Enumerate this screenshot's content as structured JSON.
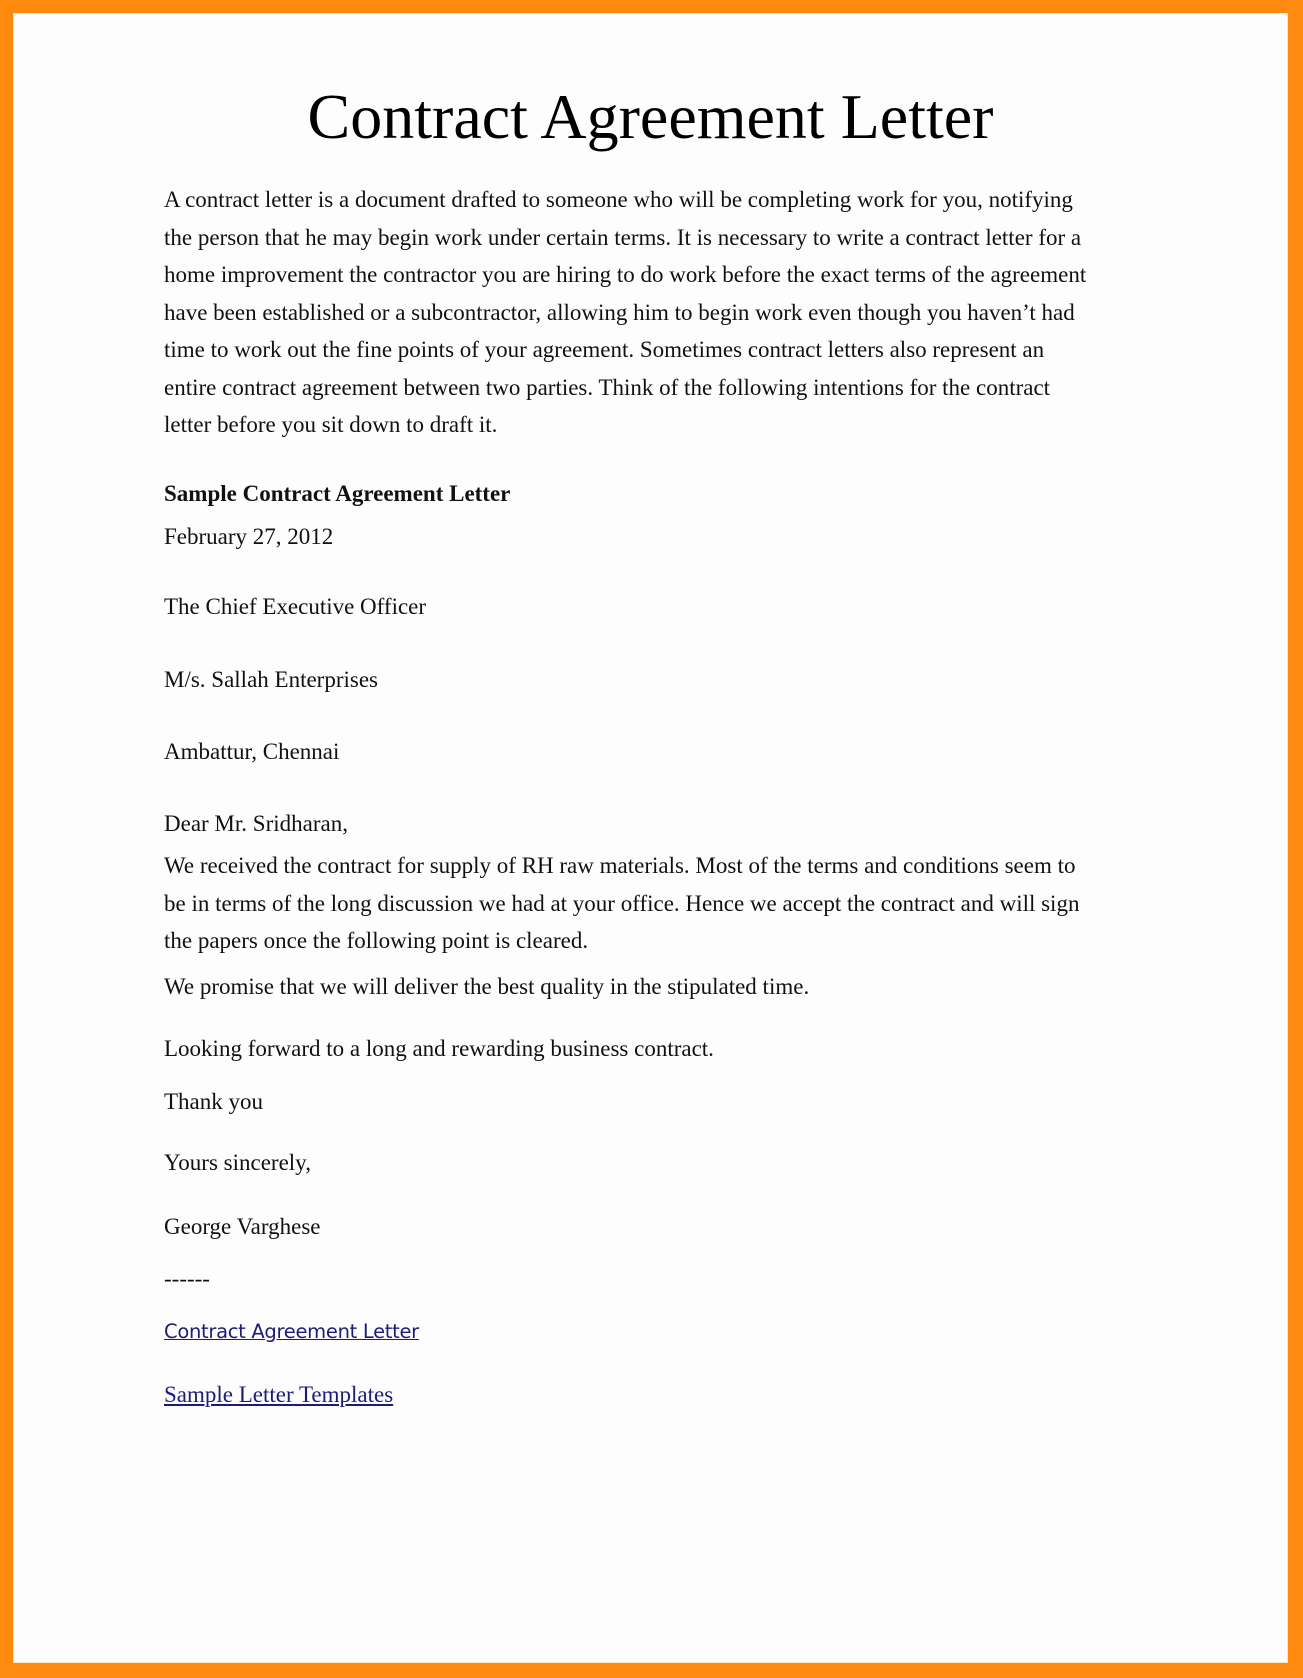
{
  "document": {
    "title": "Contract Agreement Letter",
    "intro_lines": [
      "A contract letter is a document drafted to someone who will be completing work for you, notifying",
      "the person that he may begin work under certain terms. It is necessary to write a contract letter for a",
      "home improvement the contractor you are hiring to do work before the exact terms of the agreement",
      "have been established or a subcontractor, allowing him to begin work even though you haven’t had",
      "time to work out the fine points of your agreement. Sometimes contract letters also represent an",
      "entire contract agreement between two parties. Think of the following intentions for the contract",
      "letter before you sit down to draft it."
    ],
    "sample_heading": "Sample Contract Agreement Letter",
    "date": "February 27, 2012",
    "recipient_title": "The Chief Executive Officer",
    "recipient_company": "M/s. Sallah Enterprises",
    "recipient_location": "Ambattur, Chennai",
    "salutation": "Dear Mr. Sridharan,",
    "body_lines": [
      "We received the contract for supply of RH raw materials. Most of the terms and conditions seem to",
      "be in terms of the long discussion we had at your office. Hence we accept the contract and will sign",
      "the papers once the following point is cleared."
    ],
    "promise": "We promise that we will deliver the best quality in the stipulated time.",
    "looking_forward": "Looking forward to a long and rewarding business contract.",
    "thanks": "Thank you",
    "closing": "Yours sincerely,",
    "signature": "George Varghese",
    "separator": "------",
    "links": [
      {
        "label": "Contract Agreement Letter"
      },
      {
        "label": "Sample Letter Templates"
      }
    ]
  },
  "colors": {
    "frame": "#FF8A0D",
    "link": "#1c1c78"
  }
}
